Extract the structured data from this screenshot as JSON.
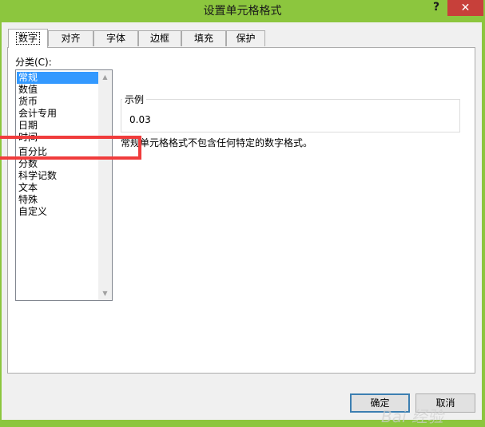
{
  "window": {
    "title": "设置单元格格式",
    "help_label": "?",
    "close_label": "✕"
  },
  "tabs": [
    {
      "label": "数字",
      "active": true
    },
    {
      "label": "对齐"
    },
    {
      "label": "字体"
    },
    {
      "label": "边框"
    },
    {
      "label": "填充"
    },
    {
      "label": "保护"
    }
  ],
  "category": {
    "label": "分类(C):",
    "items": [
      "常规",
      "数值",
      "货币",
      "会计专用",
      "日期",
      "时间",
      "百分比",
      "分数",
      "科学记数",
      "文本",
      "特殊",
      "自定义"
    ],
    "selected": "常规",
    "highlighted": "百分比"
  },
  "sample": {
    "legend": "示例",
    "value": "0.03"
  },
  "description": "常规单元格格式不包含任何特定的数字格式。",
  "buttons": {
    "ok": "确定",
    "cancel": "取消"
  },
  "watermark": "Bai 经验",
  "colors": {
    "titlebar": "#8cc63e",
    "close": "#c7403a",
    "selection": "#3399ff",
    "highlight_box": "#f03c3c"
  }
}
